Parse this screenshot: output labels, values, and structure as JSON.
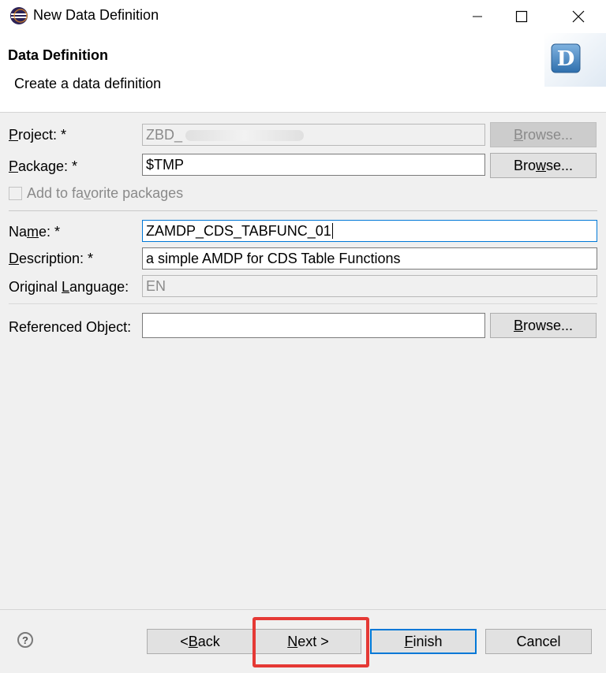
{
  "window": {
    "title": "New Data Definition"
  },
  "header": {
    "title": "Data Definition",
    "subtitle": "Create a data definition",
    "badge_letter": "D"
  },
  "form": {
    "project": {
      "label": "Project: *",
      "value": "ZBD_"
    },
    "package": {
      "label": "Package: *",
      "value": "$TMP"
    },
    "favorite": {
      "label": "Add to favorite packages",
      "checked": false
    },
    "name": {
      "label": "Name: *",
      "value": "ZAMDP_CDS_TABFUNC_01"
    },
    "description": {
      "label": "Description: *",
      "value": "a simple AMDP for CDS Table Functions"
    },
    "language": {
      "label": "Original Language:",
      "value": "EN"
    },
    "referenced": {
      "label": "Referenced Object:",
      "value": ""
    },
    "browse_label": "Browse..."
  },
  "footer": {
    "help_symbol": "?",
    "back_label": "< Back",
    "next_label": "Next >",
    "finish_label": "Finish",
    "cancel_label": "Cancel"
  },
  "colors": {
    "focus": "#0078d7",
    "highlight": "#e53935",
    "header_bg": "#ffffff",
    "content_bg": "#f0f0f0"
  }
}
